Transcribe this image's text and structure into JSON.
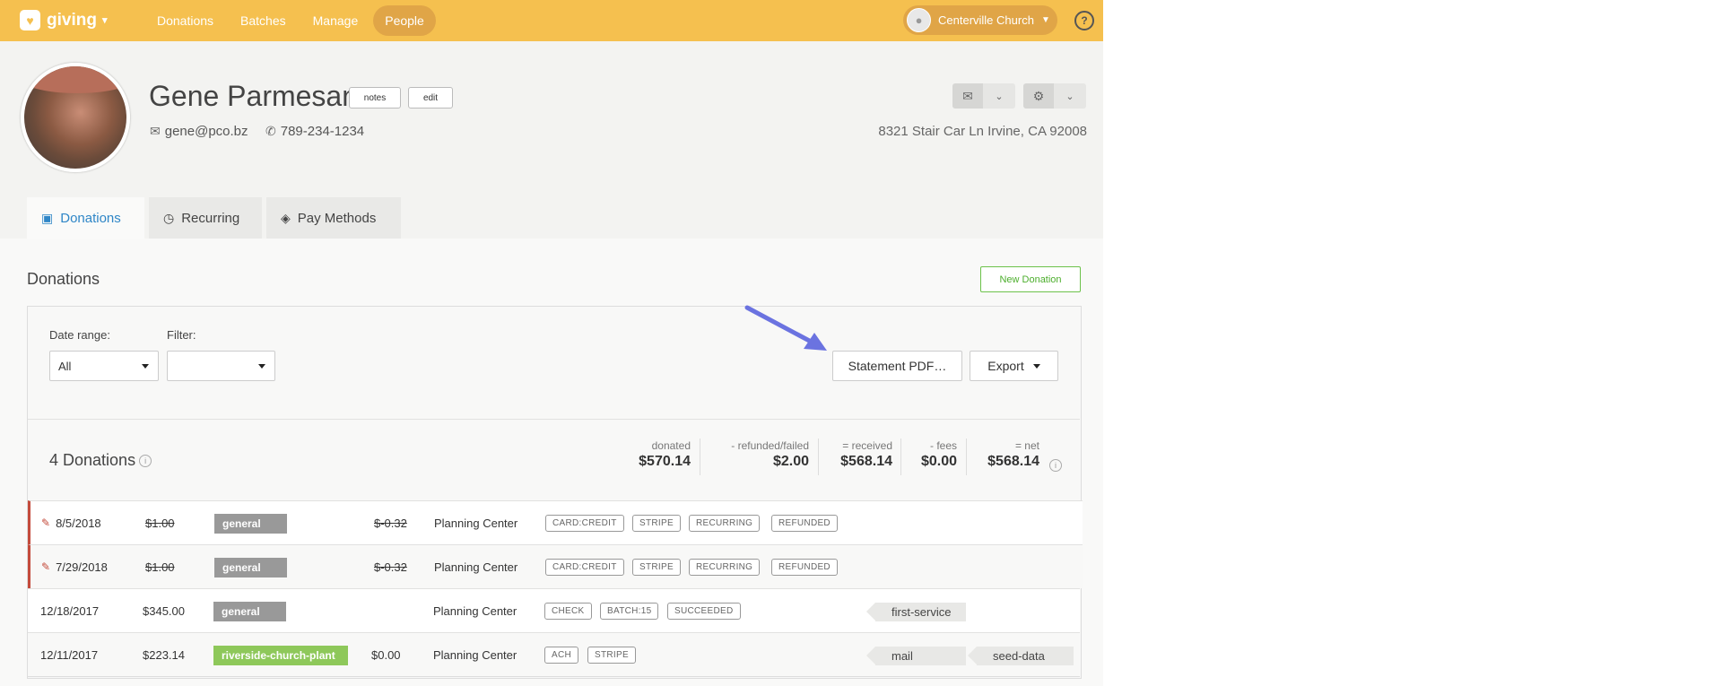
{
  "app": {
    "name": "giving"
  },
  "nav": {
    "items": [
      "Donations",
      "Batches",
      "Manage",
      "People"
    ],
    "active": "People"
  },
  "org": {
    "name": "Centerville Church"
  },
  "help": "?",
  "person": {
    "name": "Gene Parmesan",
    "notes_label": "notes",
    "edit_label": "edit",
    "email": "gene@pco.bz",
    "phone": "789-234-1234",
    "address": "8321 Stair Car Ln Irvine, CA 92008"
  },
  "tabs": [
    "Donations",
    "Recurring",
    "Pay Methods"
  ],
  "donations": {
    "title": "Donations",
    "new_button": "New Donation",
    "date_range_label": "Date range:",
    "date_range_value": "All",
    "filter_label": "Filter:",
    "filter_value": "",
    "statement_button": "Statement PDF…",
    "export_button": "Export",
    "count": "4 Donations",
    "summary": [
      {
        "label": "donated",
        "value": "$570.14"
      },
      {
        "label": "- refunded/failed",
        "value": "$2.00"
      },
      {
        "label": "= received",
        "value": "$568.14"
      },
      {
        "label": "- fees",
        "value": "$0.00"
      },
      {
        "label": "= net",
        "value": "$568.14"
      }
    ],
    "rows": [
      {
        "date": "8/5/2018",
        "amount": "$1.00",
        "fund": "general",
        "fee": "$-0.32",
        "source": "Planning Center",
        "badges": [
          "CARD:CREDIT",
          "STRIPE",
          "RECURRING",
          "REFUNDED"
        ],
        "tags": []
      },
      {
        "date": "7/29/2018",
        "amount": "$1.00",
        "fund": "general",
        "fee": "$-0.32",
        "source": "Planning Center",
        "badges": [
          "CARD:CREDIT",
          "STRIPE",
          "RECURRING",
          "REFUNDED"
        ],
        "tags": []
      },
      {
        "date": "12/18/2017",
        "amount": "$345.00",
        "fund": "general",
        "fee": "",
        "source": "Planning Center",
        "badges": [
          "CHECK",
          "BATCH:15",
          "SUCCEEDED"
        ],
        "tags": [
          "first-service"
        ]
      },
      {
        "date": "12/11/2017",
        "amount": "$223.14",
        "fund": "riverside-church-plant",
        "fee": "$0.00",
        "source": "Planning Center",
        "badges": [
          "ACH",
          "STRIPE"
        ],
        "tags": [
          "mail",
          "seed-data"
        ]
      }
    ]
  },
  "colors": {
    "brand": "#f5c04f",
    "nav_active": "#e0a547",
    "fund_general": "#999999",
    "fund_plant": "#8ec85a",
    "refund_accent": "#c44b3c",
    "tab_active": "#2f86c7",
    "new_donation": "#4cae2c",
    "arrow": "#6b73e0"
  }
}
